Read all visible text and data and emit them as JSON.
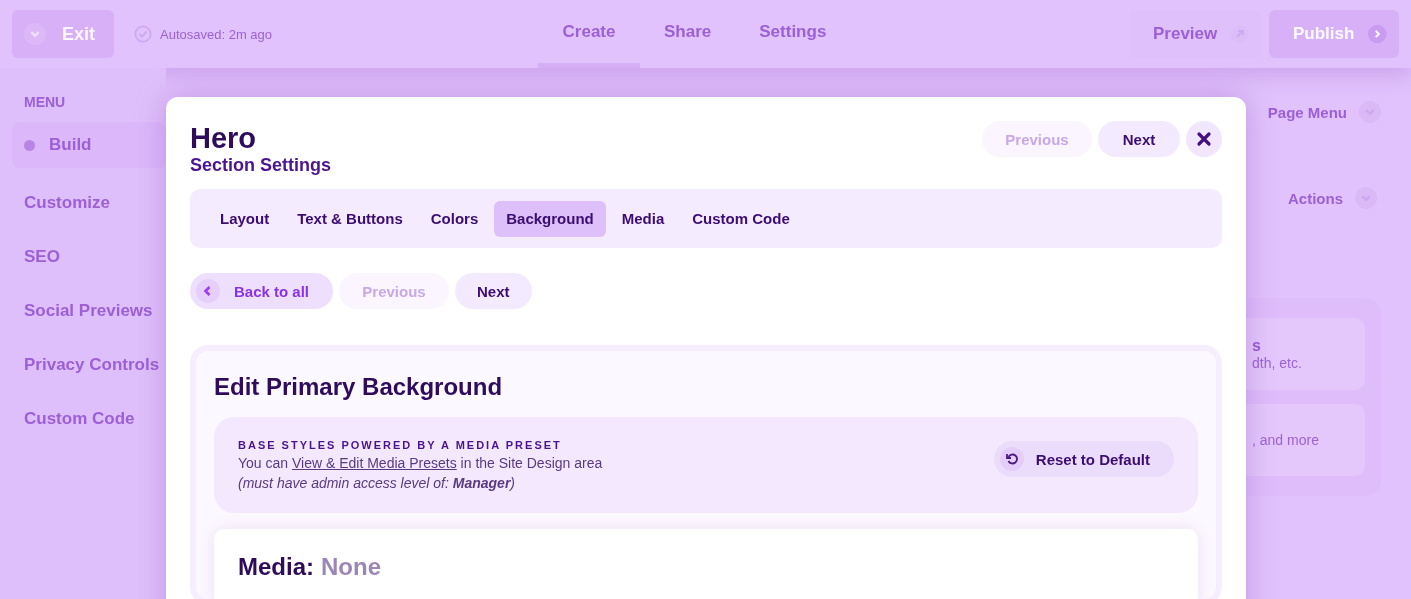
{
  "topbar": {
    "exit_label": "Exit",
    "autosave": "Autosaved: 2m ago",
    "tabs": [
      {
        "label": "Create",
        "selected": true
      },
      {
        "label": "Share",
        "selected": false
      },
      {
        "label": "Settings",
        "selected": false
      }
    ],
    "preview_label": "Preview",
    "publish_label": "Publish"
  },
  "sidebar": {
    "heading": "MENU",
    "items": [
      {
        "label": "Build",
        "selected": true
      },
      {
        "label": "Customize",
        "selected": false
      },
      {
        "label": "SEO",
        "selected": false
      },
      {
        "label": "Social Previews",
        "selected": false
      },
      {
        "label": "Privacy Controls",
        "selected": false
      },
      {
        "label": "Custom Code",
        "selected": false
      }
    ]
  },
  "right_panel": {
    "page_menu": "Page Menu",
    "actions": "Actions",
    "card_title_fragment": "s",
    "card_text_fragment": "dth, etc.",
    "card2_text_fragment": ", and more"
  },
  "modal": {
    "title": "Hero",
    "subtitle": "Section Settings",
    "header_nav": [
      {
        "label": "Previous",
        "disabled": true
      },
      {
        "label": "Next",
        "disabled": false
      }
    ],
    "tabs": [
      {
        "label": "Layout",
        "selected": false
      },
      {
        "label": "Text & Buttons",
        "selected": false
      },
      {
        "label": "Colors",
        "selected": false
      },
      {
        "label": "Background",
        "selected": true
      },
      {
        "label": "Media",
        "selected": false
      },
      {
        "label": "Custom Code",
        "selected": false
      }
    ],
    "back_label": "Back to all",
    "nav": [
      {
        "label": "Previous",
        "disabled": true
      },
      {
        "label": "Next",
        "disabled": false
      }
    ],
    "section_title": "Edit Primary Background",
    "preset": {
      "heading": "BASE STYLES POWERED BY A MEDIA PRESET",
      "text_before": "You can",
      "link": "View & Edit Media Presets",
      "text_after": "in the Site Design area",
      "note": "(must have admin access level of: **Manager**)",
      "reset_label": "Reset to Default"
    },
    "media": {
      "label": "Media:",
      "value": "None"
    }
  }
}
